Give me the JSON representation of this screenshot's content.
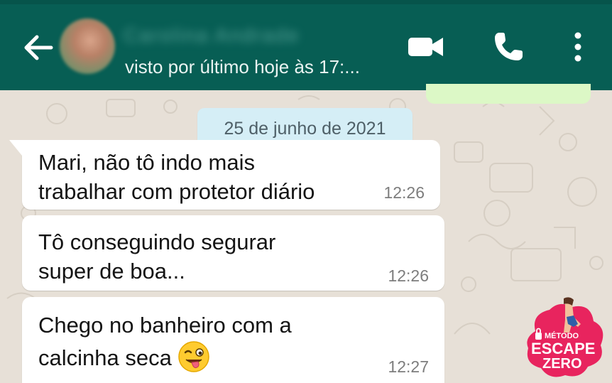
{
  "header": {
    "contact_name": "Carolina Andrade",
    "status": "visto por último hoje às 17:...",
    "background_color": "#075e54",
    "icons": [
      "back-arrow-icon",
      "video-call-icon",
      "phone-icon",
      "more-vertical-icon"
    ]
  },
  "chat": {
    "date_chip": "25 de junho de 2021",
    "messages": [
      {
        "line1": "Mari, não tô indo mais",
        "line2": "trabalhar com protetor diário",
        "time": "12:26"
      },
      {
        "line1": "Tô conseguindo segurar",
        "line2": "super de boa...",
        "time": "12:26"
      },
      {
        "line1": "Chego no banheiro com a",
        "line2": "calcinha seca",
        "emoji": "winking-face-with-tongue",
        "time": "12:27"
      }
    ],
    "bubble_color": "#ffffff",
    "outgoing_bubble_color": "#dcf8c6",
    "wallpaper_color": "#e7e0d7"
  },
  "logo": {
    "line1": "MÉTODO",
    "line2": "ESCAPE",
    "line3": "ZERO",
    "color": "#e8245e"
  }
}
